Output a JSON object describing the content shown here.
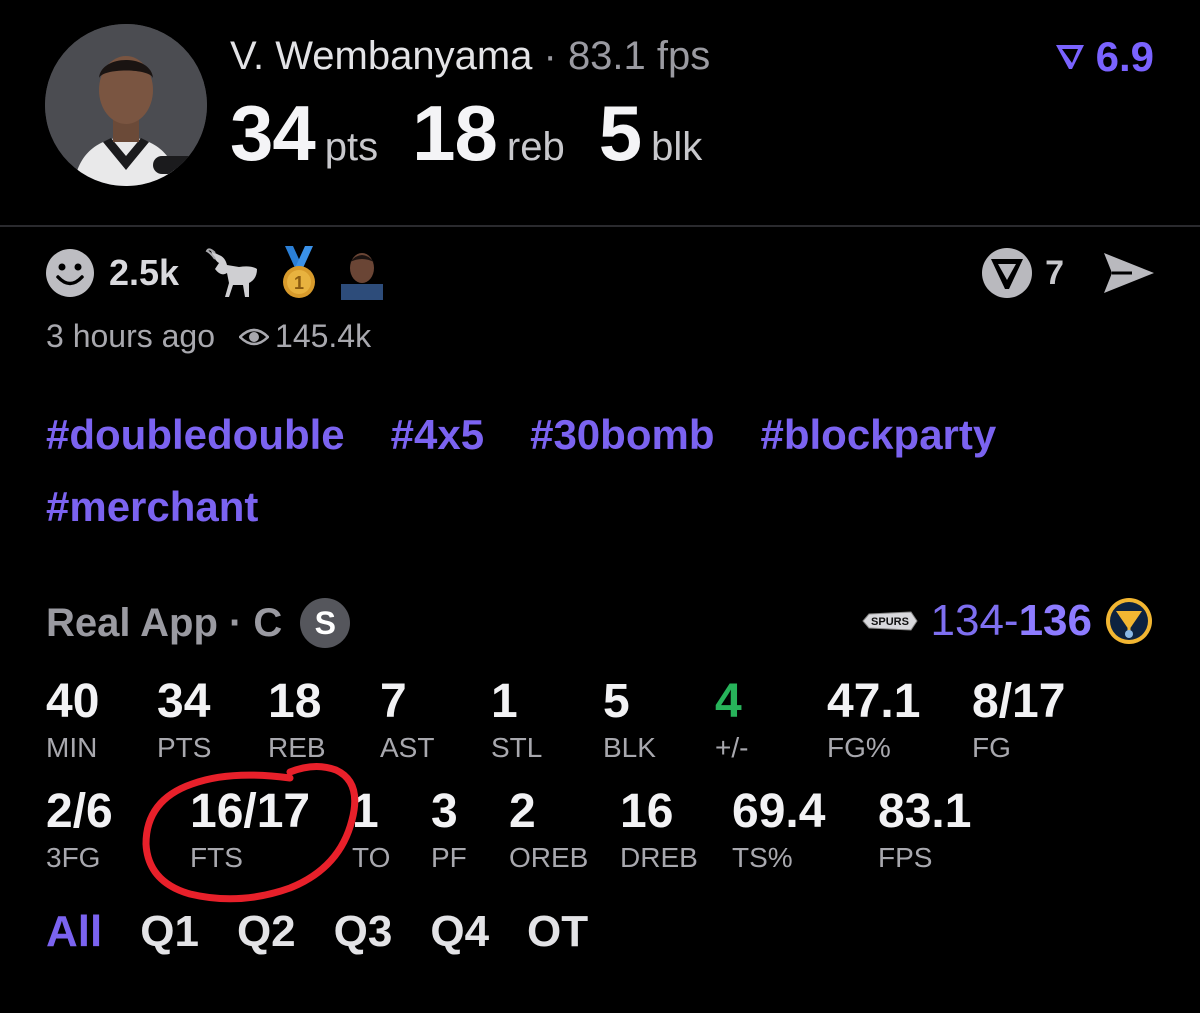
{
  "header": {
    "player_name": "V. Wembanyama",
    "separator": " · ",
    "fps_text": "83.1 fps",
    "rating": "6.9",
    "headline": [
      {
        "value": "34",
        "unit": "pts"
      },
      {
        "value": "18",
        "unit": "reb"
      },
      {
        "value": "5",
        "unit": "blk"
      }
    ]
  },
  "reactions": {
    "count": "2.5k",
    "icons": [
      "smiley-icon",
      "goat-icon",
      "gold-medal-icon",
      "player-avatar-icon"
    ],
    "comments": "7",
    "time_ago": "3 hours ago",
    "views": "145.4k"
  },
  "hashtags": [
    "#doubledouble",
    "#4x5",
    "#30bomb",
    "#blockparty",
    "#merchant"
  ],
  "game": {
    "source": "Real App · C",
    "badge": "S",
    "score_home": "134-",
    "score_away": "136"
  },
  "stats_row1": [
    {
      "value": "40",
      "label": "MIN"
    },
    {
      "value": "34",
      "label": "PTS"
    },
    {
      "value": "18",
      "label": "REB"
    },
    {
      "value": "7",
      "label": "AST"
    },
    {
      "value": "1",
      "label": "STL"
    },
    {
      "value": "5",
      "label": "BLK"
    },
    {
      "value": "4",
      "label": "+/-"
    },
    {
      "value": "47.1",
      "label": "FG%"
    },
    {
      "value": "8/17",
      "label": "FG"
    }
  ],
  "stats_row2": [
    {
      "value": "2/6",
      "label": "3FG"
    },
    {
      "value": "16/17",
      "label": "FTS"
    },
    {
      "value": "1",
      "label": "TO"
    },
    {
      "value": "3",
      "label": "PF"
    },
    {
      "value": "2",
      "label": "OREB"
    },
    {
      "value": "16",
      "label": "DREB"
    },
    {
      "value": "69.4",
      "label": "TS%"
    },
    {
      "value": "83.1",
      "label": "FPS"
    }
  ],
  "periods": [
    "All",
    "Q1",
    "Q2",
    "Q3",
    "Q4",
    "OT"
  ],
  "colors": {
    "accent": "#7b63f0",
    "positive": "#27b35a",
    "annotation": "#e8202a"
  }
}
